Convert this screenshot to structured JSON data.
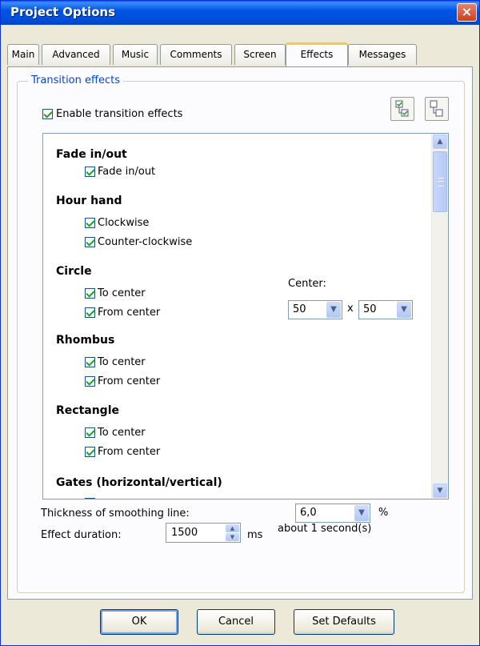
{
  "window": {
    "title": "Project Options",
    "close_label": "×"
  },
  "tabs": [
    {
      "label": "Main"
    },
    {
      "label": "Advanced"
    },
    {
      "label": "Music"
    },
    {
      "label": "Comments"
    },
    {
      "label": "Screen"
    },
    {
      "label": "Effects",
      "active": true
    },
    {
      "label": "Messages"
    }
  ],
  "group": {
    "legend": "Transition effects",
    "enable_label": "Enable transition effects",
    "enable_checked": true
  },
  "effects": {
    "fade": {
      "heading": "Fade in/out",
      "options": [
        "Fade in/out"
      ]
    },
    "hour_hand": {
      "heading": "Hour hand",
      "options": [
        "Clockwise",
        "Counter-clockwise"
      ]
    },
    "circle": {
      "heading": "Circle",
      "options": [
        "To center",
        "From center"
      ],
      "center_label": "Center:",
      "center_x": "50",
      "center_sep": "x",
      "center_y": "50"
    },
    "rhombus": {
      "heading": "Rhombus",
      "options": [
        "To center",
        "From center"
      ]
    },
    "rectangle": {
      "heading": "Rectangle",
      "options": [
        "To center",
        "From center"
      ]
    },
    "gates": {
      "heading": "Gates (horizontal/vertical)"
    }
  },
  "smoothing": {
    "label": "Thickness of smoothing line:",
    "value": "6,0",
    "unit": "%"
  },
  "duration": {
    "label": "Effect duration:",
    "value": "1500",
    "unit": "ms",
    "note": "about 1 second(s)"
  },
  "buttons": {
    "ok": "OK",
    "cancel": "Cancel",
    "defaults": "Set Defaults"
  },
  "colors": {
    "titlebar": "#0054e3",
    "accent": "#0046d5",
    "check": "#21a121",
    "active_tab": "#ffc83c"
  }
}
